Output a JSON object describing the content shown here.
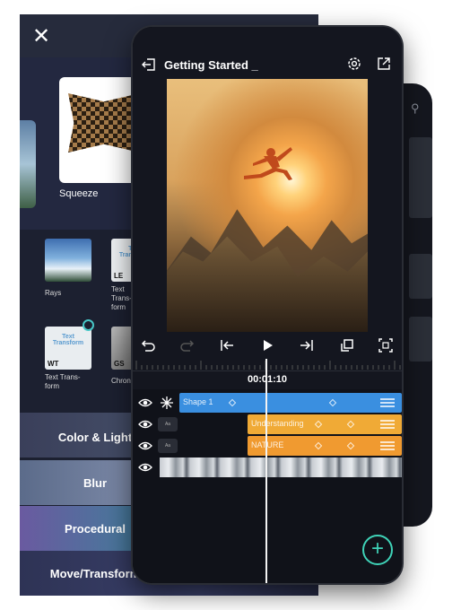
{
  "effects_panel": {
    "featured_label": "Squeeze",
    "effects": [
      {
        "label": "Rays",
        "code": ""
      },
      {
        "label": "Text Trans-\nform",
        "code": "LE",
        "thumb_text": "Text Transform"
      },
      {
        "label": "Text Trans-\nform",
        "code": "WT",
        "thumb_text": "Text Transform"
      },
      {
        "label": "Chron",
        "code": "GS"
      }
    ],
    "categories": [
      "Color & Light",
      "Blur",
      "Procedural",
      "Move/Transform"
    ]
  },
  "editor": {
    "project_title": "Getting Started _",
    "timecode": "00:01:10",
    "tracks": [
      {
        "name": "Shape 1",
        "color": "#3a8fe0"
      },
      {
        "name": "Understanding",
        "color": "#f0aa36"
      },
      {
        "name": "NATURE",
        "color": "#f09a30"
      },
      {
        "name": "",
        "color": "#c8ccd2"
      }
    ],
    "add_button": "+"
  }
}
